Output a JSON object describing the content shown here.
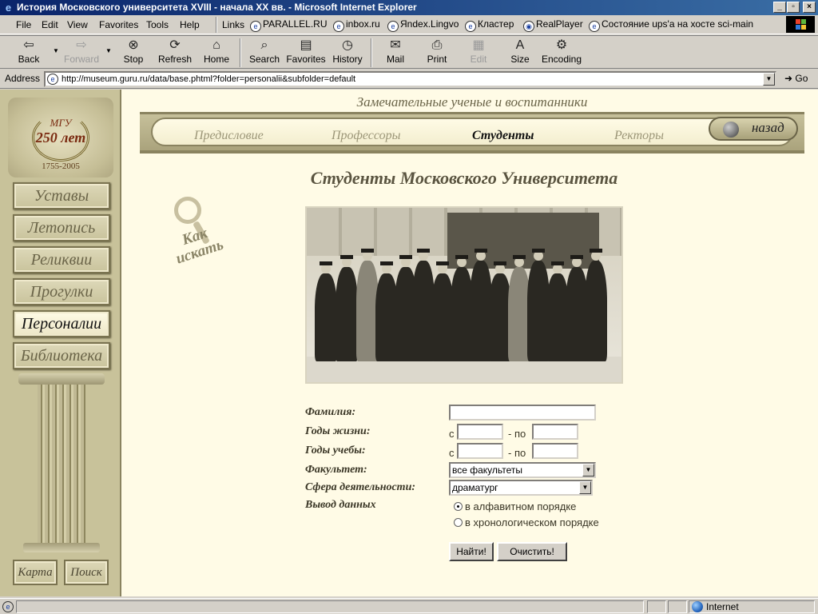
{
  "window": {
    "title": "История Московского университета XVIII - начала XX вв. - Microsoft Internet Explorer",
    "min": "_",
    "max": "▫",
    "close": "×"
  },
  "menu": {
    "items": [
      "File",
      "Edit",
      "View",
      "Favorites",
      "Tools",
      "Help"
    ],
    "links_label": "Links",
    "links": [
      "PARALLEL.RU",
      "inbox.ru",
      "Яndex.Lingvo",
      "Кластер",
      "RealPlayer",
      "Состояние ups'a на хосте sci-main"
    ]
  },
  "toolbar": {
    "back": "Back",
    "forward": "Forward",
    "stop": "Stop",
    "refresh": "Refresh",
    "home": "Home",
    "search": "Search",
    "favorites": "Favorites",
    "history": "History",
    "mail": "Mail",
    "print": "Print",
    "edit": "Edit",
    "size": "Size",
    "encoding": "Encoding"
  },
  "address": {
    "label": "Address",
    "url": "http://museum.guru.ru/data/base.phtml?folder=personalii&subfolder=default",
    "go": "Go"
  },
  "sidebar": {
    "seal_top": "МГУ",
    "seal_big": "250 лет",
    "seal_years": "1755-2005",
    "items": [
      {
        "label": "Уставы",
        "active": false
      },
      {
        "label": "Летопись",
        "active": false
      },
      {
        "label": "Реликвии",
        "active": false
      },
      {
        "label": "Прогулки",
        "active": false
      },
      {
        "label": "Персоналии",
        "active": true
      },
      {
        "label": "Библиотека",
        "active": false
      }
    ],
    "map": "Карта",
    "search": "Поиск"
  },
  "section": {
    "title": "Замечательные ученые и воспитанники",
    "tabs": [
      {
        "label": "Предисловие",
        "active": false
      },
      {
        "label": "Профессоры",
        "active": false
      },
      {
        "label": "Студенты",
        "active": true
      },
      {
        "label": "Ректоры",
        "active": false
      }
    ],
    "back": "назад"
  },
  "content": {
    "heading": "Студенты Московского Университета",
    "howto_line1": "Как",
    "howto_line2": "искать"
  },
  "form": {
    "surname_label": "Фамилия:",
    "surname_value": "",
    "life_label": "Годы жизни:",
    "study_label": "Годы учебы:",
    "from": "с",
    "to": "- по",
    "life_from": "",
    "life_to": "",
    "study_from": "",
    "study_to": "",
    "faculty_label": "Факультет:",
    "faculty_value": "все факультеты",
    "sphere_label": "Сфера деятельности:",
    "sphere_value": "драматург",
    "output_label": "Вывод данных",
    "order_alpha": "в алфавитном порядке",
    "order_chrono": "в хронологическом порядке",
    "selected_order": "alpha",
    "find_button": "Найти!",
    "clear_button": "Очистить!"
  },
  "status": {
    "zone": "Internet"
  }
}
